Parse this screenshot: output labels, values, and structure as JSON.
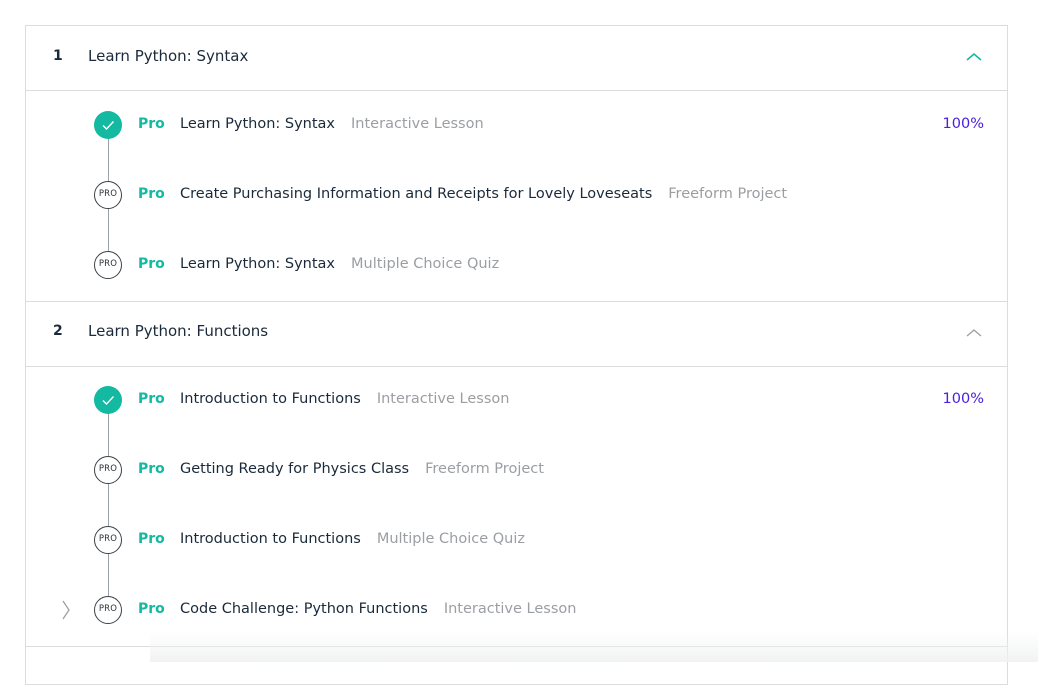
{
  "colors": {
    "accent_teal": "#13b9a0",
    "percent_purple": "#4a1fe0",
    "text_dark": "#1a2a3a",
    "text_muted": "#9b9ea2",
    "border": "#dcdcdc"
  },
  "sections": [
    {
      "number": "1",
      "title": "Learn Python: Syntax",
      "chevron_icon": "chevron-up-icon",
      "chevron_color": "#13b9a0",
      "items": [
        {
          "status": "completed",
          "node_icon": "check-circle-icon",
          "badge": "Pro",
          "title": "Learn Python: Syntax",
          "kind": "Interactive Lesson",
          "progress": "100%"
        },
        {
          "status": "locked",
          "node_label": "PRO",
          "badge": "Pro",
          "title": "Create Purchasing Information and Receipts for Lovely Loveseats",
          "kind": "Freeform Project",
          "progress": ""
        },
        {
          "status": "locked",
          "node_label": "PRO",
          "badge": "Pro",
          "title": "Learn Python: Syntax",
          "kind": "Multiple Choice Quiz",
          "progress": ""
        }
      ]
    },
    {
      "number": "2",
      "title": "Learn Python: Functions",
      "chevron_icon": "chevron-up-icon",
      "chevron_color": "#9aa1a7",
      "items": [
        {
          "status": "completed",
          "node_icon": "check-circle-icon",
          "badge": "Pro",
          "title": "Introduction to Functions",
          "kind": "Interactive Lesson",
          "progress": "100%"
        },
        {
          "status": "locked",
          "node_label": "PRO",
          "badge": "Pro",
          "title": "Getting Ready for Physics Class",
          "kind": "Freeform Project",
          "progress": ""
        },
        {
          "status": "locked",
          "node_label": "PRO",
          "badge": "Pro",
          "title": "Introduction to Functions",
          "kind": "Multiple Choice Quiz",
          "progress": ""
        },
        {
          "status": "locked",
          "node_label": "PRO",
          "badge": "Pro",
          "title": "Code Challenge: Python Functions",
          "kind": "Interactive Lesson",
          "progress": "",
          "current_icon": "chevron-right-icon"
        }
      ]
    }
  ]
}
